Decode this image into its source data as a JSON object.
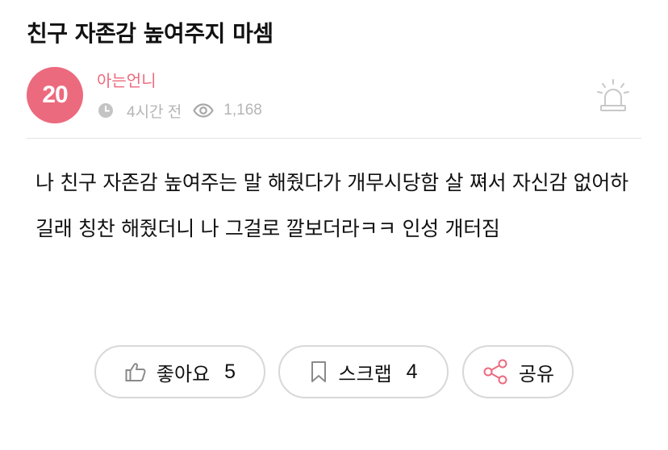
{
  "post": {
    "title": "친구 자존감 높여주지 마셈",
    "author_level": "20",
    "author_name": "아는언니",
    "time_ago": "4시간 전",
    "views": "1,168",
    "body": "나 친구 자존감 높여주는 말 해줬다가 개무시당함 살 쪄서 자신감 없어하길래 칭찬 해줬더니 나 그걸로 깔보더라ㅋㅋ 인성 개터짐"
  },
  "actions": {
    "like_label": "좋아요",
    "like_count": "5",
    "scrap_label": "스크랩",
    "scrap_count": "4",
    "share_label": "공유"
  },
  "icons": {
    "clock": "clock-icon",
    "eye": "eye-icon",
    "report": "siren-icon",
    "like": "thumbs-up-icon",
    "scrap": "bookmark-icon",
    "share": "share-icon"
  },
  "colors": {
    "accent": "#ec6a7e",
    "meta_gray": "#b5b5b5",
    "border": "#d8d8d8"
  }
}
